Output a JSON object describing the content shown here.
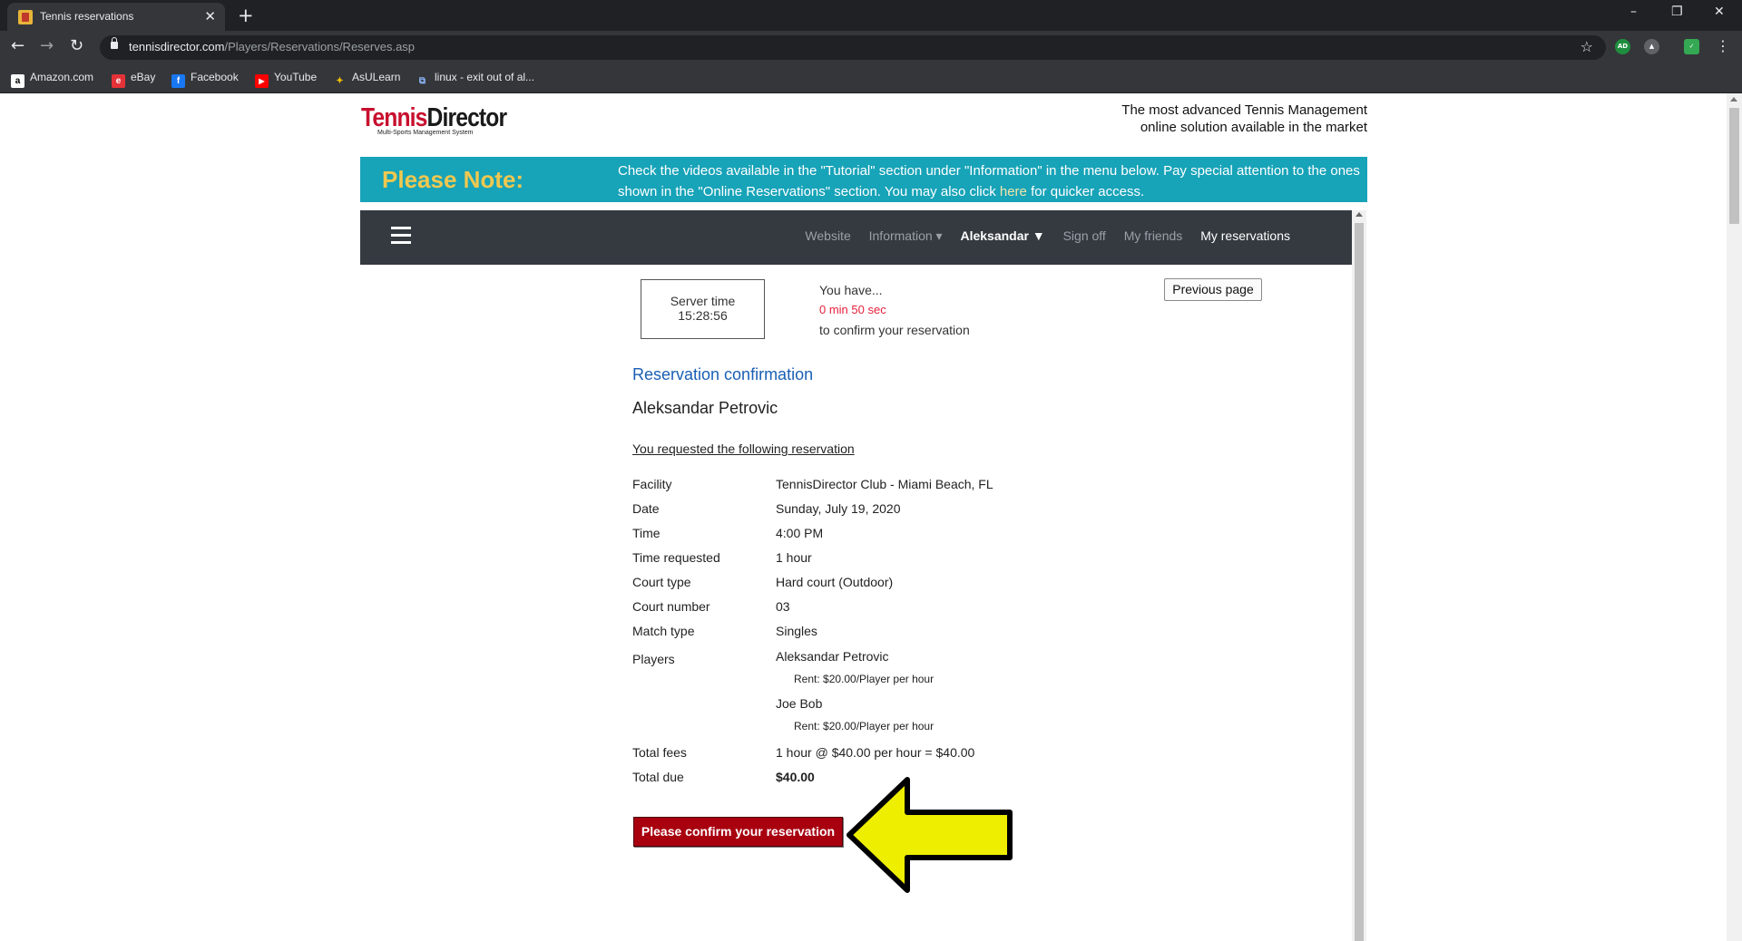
{
  "browser": {
    "tab_title": "Tennis reservations",
    "tab_close": "✕",
    "new_tab": "+",
    "url_host": "tennisdirector.com",
    "url_path": "/Players/Reservations/Reserves.asp",
    "window_controls": [
      "–",
      "❐",
      "✕"
    ],
    "nav": [
      "←",
      "→",
      "↻"
    ],
    "bookmarks": [
      {
        "label": "Amazon.com",
        "icon": "amazon-icon",
        "glyph": "a",
        "bg": "#ffffff",
        "fg": "#000000"
      },
      {
        "label": "eBay",
        "icon": "ebay-icon",
        "glyph": "e",
        "bg": "#e53238",
        "fg": "#ffffff"
      },
      {
        "label": "Facebook",
        "icon": "facebook-icon",
        "glyph": "f",
        "bg": "#1877f2",
        "fg": "#ffffff"
      },
      {
        "label": "YouTube",
        "icon": "youtube-icon",
        "glyph": "▶",
        "bg": "#ff0000",
        "fg": "#ffffff"
      },
      {
        "label": "AsULearn",
        "icon": "asulearn-icon",
        "glyph": "✦",
        "bg": "#35363a",
        "fg": "#f2c200"
      },
      {
        "label": "linux - exit out of al...",
        "icon": "linux-icon",
        "glyph": "⧉",
        "bg": "#35363a",
        "fg": "#8ab4f8"
      }
    ],
    "extensions": [
      {
        "name": "ad-icon",
        "text": "AD",
        "color": "#1e8e3e"
      },
      {
        "name": "drive-icon",
        "text": "▲",
        "color": "#5f6368"
      },
      {
        "name": "shield-icon",
        "text": "✓",
        "color": "#34a853"
      }
    ]
  },
  "site": {
    "logo_tennis": "Tennis",
    "logo_director": "Director",
    "logo_sub": "Multi-Sports Management System",
    "tagline_1": "The most advanced Tennis Management",
    "tagline_2": "online solution available in the market",
    "note_title": "Please Note:",
    "note_text_1": "Check the videos available in the \"Tutorial\" section under \"Information\" in the menu below. Pay special attention to the ones shown in the \"Online Reservations\" section. You may also click ",
    "note_link": "here",
    "note_text_2": " for quicker access.",
    "nav": {
      "website": "Website",
      "information": "Information ▾",
      "user": "Aleksandar ▼",
      "sign_off": "Sign off",
      "my_friends": "My friends",
      "my_reservations": "My reservations"
    }
  },
  "content": {
    "server_label": "Server time",
    "server_time": "15:28:56",
    "timer_line1": "You have...",
    "timer_countdown": "0 min 50 sec",
    "timer_line3": "to confirm your reservation",
    "prev_button": "Previous page",
    "title": "Reservation confirmation",
    "player_name": "Aleksandar Petrovic",
    "requested": "You requested the following reservation",
    "details": [
      {
        "label": "Facility",
        "value": "TennisDirector Club - Miami Beach, FL"
      },
      {
        "label": "Date",
        "value": "Sunday, July 19, 2020"
      },
      {
        "label": "Time",
        "value": "4:00 PM"
      },
      {
        "label": "Time requested",
        "value": "1 hour"
      },
      {
        "label": "Court type",
        "value": "Hard court (Outdoor)"
      },
      {
        "label": "Court number",
        "value": "03"
      },
      {
        "label": "Match type",
        "value": "Singles"
      }
    ],
    "players_label": "Players",
    "players": [
      {
        "name": "Aleksandar Petrovic",
        "rent": "Rent: $20.00/Player per hour"
      },
      {
        "name": "Joe Bob",
        "rent": "Rent: $20.00/Player per hour"
      }
    ],
    "total_fees_label": "Total fees",
    "total_fees": "1 hour @ $40.00 per hour = $40.00",
    "total_due_label": "Total due",
    "total_due": "$40.00",
    "confirm_button": "Please confirm your reservation"
  }
}
